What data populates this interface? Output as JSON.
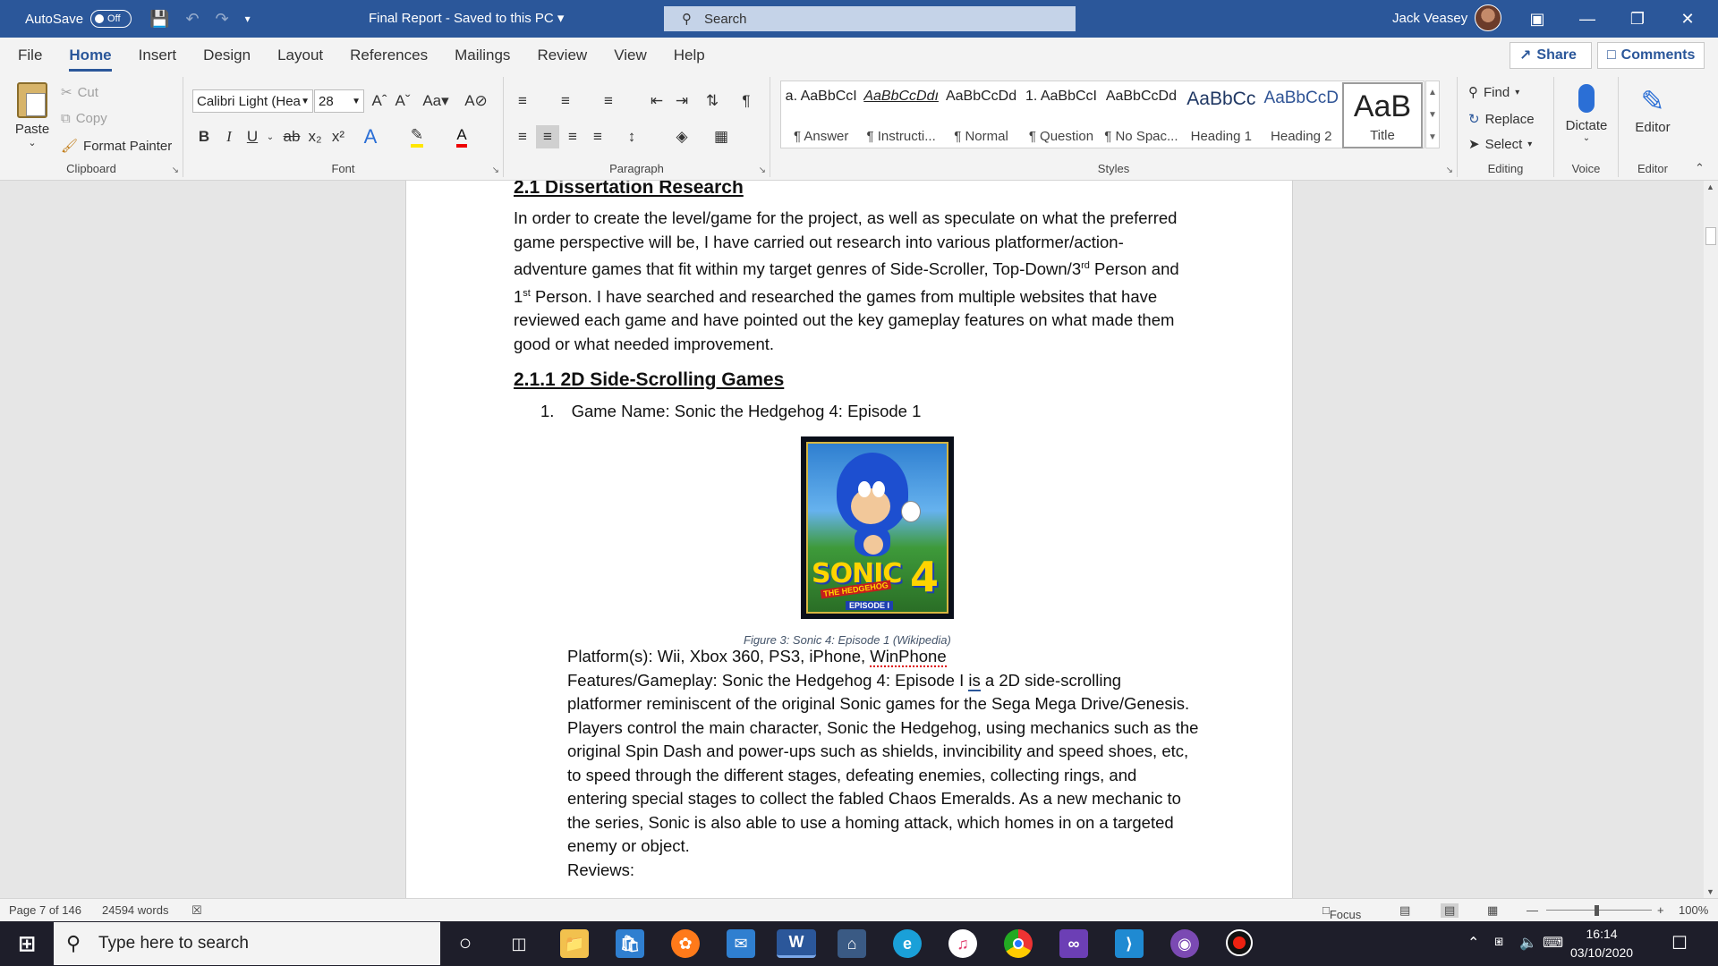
{
  "titlebar": {
    "autosave_label": "AutoSave",
    "autosave_state": "Off",
    "doc_title": "Final Report  -  Saved to this PC",
    "search_label": "Search",
    "user_name": "Jack Veasey"
  },
  "tabs": [
    "File",
    "Home",
    "Insert",
    "Design",
    "Layout",
    "References",
    "Mailings",
    "Review",
    "View",
    "Help"
  ],
  "share_label": "Share",
  "comments_label": "Comments",
  "ribbon": {
    "clipboard": {
      "paste": "Paste",
      "cut": "Cut",
      "copy": "Copy",
      "format_painter": "Format Painter",
      "label": "Clipboard"
    },
    "font": {
      "name": "Calibri Light (Hea",
      "size": "28",
      "label": "Font"
    },
    "paragraph": {
      "label": "Paragraph"
    },
    "styles": {
      "label": "Styles",
      "items": [
        {
          "preview": "a. AaBbCcI",
          "name": "¶ Answer"
        },
        {
          "preview": "AaBbCcDdı",
          "name": "¶ Instructi..."
        },
        {
          "preview": "AaBbCcDd",
          "name": "¶ Normal"
        },
        {
          "preview": "1. AaBbCcI",
          "name": "¶ Question"
        },
        {
          "preview": "AaBbCcDd",
          "name": "¶ No Spac..."
        },
        {
          "preview": "AaBbCc",
          "name": "Heading 1"
        },
        {
          "preview": "AaBbCcD",
          "name": "Heading 2"
        },
        {
          "preview": "AaB",
          "name": "Title"
        }
      ]
    },
    "editing": {
      "find": "Find",
      "replace": "Replace",
      "select": "Select",
      "label": "Editing"
    },
    "voice": {
      "dictate": "Dictate",
      "label": "Voice"
    },
    "editor": {
      "editor": "Editor",
      "label": "Editor"
    }
  },
  "document": {
    "h_21": "2.1 Dissertation Research",
    "p1_lines": [
      "In order to create the level/game for the project, as well as speculate on what the preferred",
      "game perspective will be, I have carried out research into various platformer/action-",
      "adventure games that fit within my target genres of Side-Scroller, Top-Down/3",
      "Person. I have searched and researched the games from multiple websites that have",
      "reviewed each game and have pointed out the key gameplay features on what made them",
      "good or what needed improvement."
    ],
    "sup_rd": "rd",
    "p1_line3_tail": " Person and",
    "p1_line4_prefix": "1",
    "sup_st": "st",
    "h_211": "2.1.1 2D Side-Scrolling Games",
    "list_num": "1.",
    "game_name": "Game Name: Sonic the Hedgehog 4: Episode 1",
    "caption": "Figure 3: Sonic 4: Episode 1 (Wikipedia)",
    "platforms_prefix": "Platform(s): Wii, Xbox 360, PS3, iPhone, ",
    "platforms_winphone": "WinPhone",
    "features_line1_a": "Features/Gameplay:  Sonic the Hedgehog 4: Episode I ",
    "features_line1_is": "is",
    "features_line1_b": " a 2D side-scrolling",
    "features_lines": [
      "platformer reminiscent of the original Sonic games for the Sega Mega Drive/Genesis.",
      "Players control the main character, Sonic the Hedgehog, using mechanics such as the",
      "original Spin Dash and power-ups such as shields, invincibility and speed shoes, etc,",
      "to speed through the different stages, defeating enemies, collecting rings, and",
      "entering special stages to collect the fabled Chaos Emeralds. As a new mechanic to",
      "the series, Sonic is also able to use a homing attack, which homes in on a targeted",
      "enemy or object."
    ],
    "reviews": "Reviews:",
    "cover_text": {
      "title": "SONIC",
      "sub": "THE HEDGEHOG",
      "num": "4",
      "ep": "EPISODE I"
    }
  },
  "statusbar": {
    "page": "Page 7 of 146",
    "words": "24594 words",
    "focus": "Focus",
    "zoom": "100%"
  },
  "taskbar": {
    "search_placeholder": "Type here to search",
    "time": "16:14",
    "date": "03/10/2020"
  }
}
